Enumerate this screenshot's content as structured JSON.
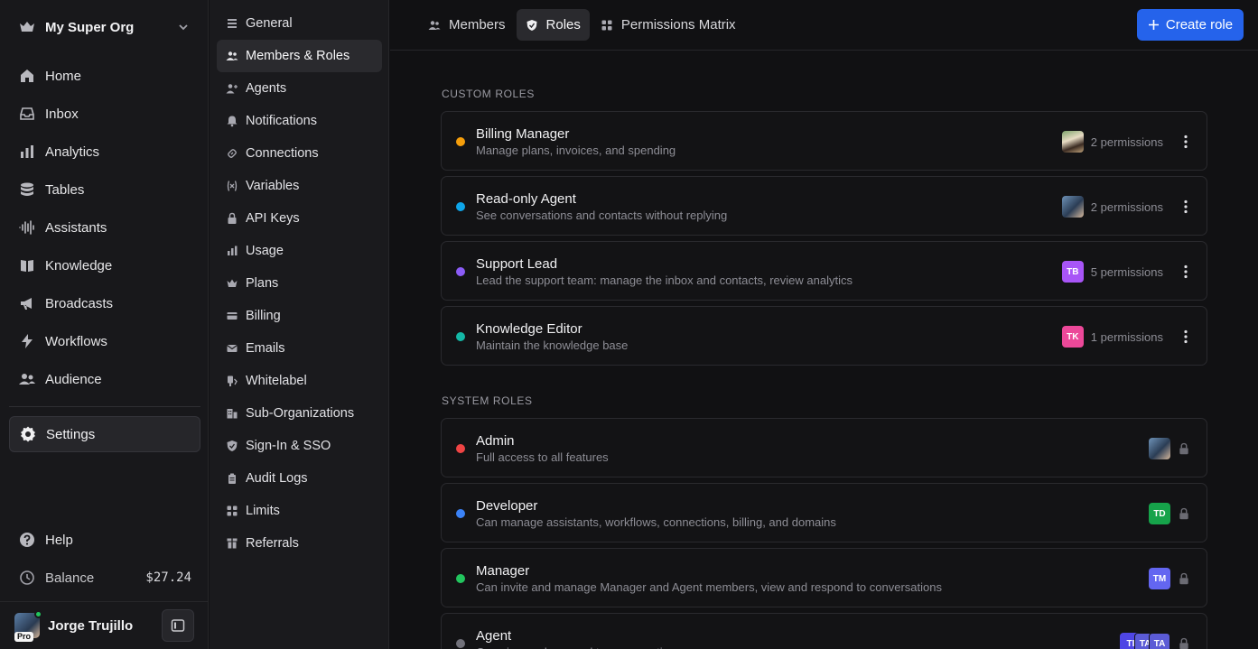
{
  "org": {
    "name": "My Super Org"
  },
  "nav": {
    "items": [
      {
        "label": "Home",
        "icon": "home-icon"
      },
      {
        "label": "Inbox",
        "icon": "inbox-icon"
      },
      {
        "label": "Analytics",
        "icon": "bar-chart-icon"
      },
      {
        "label": "Tables",
        "icon": "database-icon"
      },
      {
        "label": "Assistants",
        "icon": "waveform-icon"
      },
      {
        "label": "Knowledge",
        "icon": "book-icon"
      },
      {
        "label": "Broadcasts",
        "icon": "megaphone-icon"
      },
      {
        "label": "Workflows",
        "icon": "lightning-icon"
      },
      {
        "label": "Audience",
        "icon": "people-icon"
      }
    ],
    "settings": "Settings",
    "help": "Help",
    "balance_label": "Balance",
    "balance_value": "$27.24"
  },
  "user": {
    "name": "Jorge Trujillo",
    "badge": "Pro"
  },
  "subnav": {
    "items": [
      {
        "label": "General",
        "icon": "stack-icon"
      },
      {
        "label": "Members & Roles",
        "icon": "people-icon"
      },
      {
        "label": "Agents",
        "icon": "user-plus-icon"
      },
      {
        "label": "Notifications",
        "icon": "bell-icon"
      },
      {
        "label": "Connections",
        "icon": "link-icon"
      },
      {
        "label": "Variables",
        "icon": "variable-icon"
      },
      {
        "label": "API Keys",
        "icon": "lock-icon"
      },
      {
        "label": "Usage",
        "icon": "bar-chart-icon"
      },
      {
        "label": "Plans",
        "icon": "crown-icon"
      },
      {
        "label": "Billing",
        "icon": "credit-card-icon"
      },
      {
        "label": "Emails",
        "icon": "mail-icon"
      },
      {
        "label": "Whitelabel",
        "icon": "brush-icon"
      },
      {
        "label": "Sub-Organizations",
        "icon": "building-icon"
      },
      {
        "label": "Sign-In & SSO",
        "icon": "shield-icon"
      },
      {
        "label": "Audit Logs",
        "icon": "clipboard-icon"
      },
      {
        "label": "Limits",
        "icon": "grid-icon"
      },
      {
        "label": "Referrals",
        "icon": "gift-icon"
      }
    ],
    "active_index": 1
  },
  "tabs": [
    {
      "label": "Members",
      "icon": "people-icon"
    },
    {
      "label": "Roles",
      "icon": "shield-check-icon"
    },
    {
      "label": "Permissions Matrix",
      "icon": "grid-icon"
    }
  ],
  "active_tab": 1,
  "create_button": "Create role",
  "custom_roles": {
    "title": "CUSTOM ROLES",
    "items": [
      {
        "name": "Billing Manager",
        "description": "Manage plans, invoices, and spending",
        "color": "#f59e0b",
        "permissions": "2 permissions",
        "avatars": [
          "photo-a"
        ]
      },
      {
        "name": "Read-only Agent",
        "description": "See conversations and contacts without replying",
        "color": "#0ea5e9",
        "permissions": "2 permissions",
        "avatars": [
          "photo-b"
        ]
      },
      {
        "name": "Support Lead",
        "description": "Lead the support team: manage the inbox and contacts, review analytics",
        "color": "#8b5cf6",
        "permissions": "5 permissions",
        "avatars": [
          "TB"
        ]
      },
      {
        "name": "Knowledge Editor",
        "description": "Maintain the knowledge base",
        "color": "#14b8a6",
        "permissions": "1 permissions",
        "avatars": [
          "TK"
        ]
      }
    ]
  },
  "system_roles": {
    "title": "SYSTEM ROLES",
    "items": [
      {
        "name": "Admin",
        "description": "Full access to all features",
        "color": "#ef4444",
        "avatars": [
          "photo-b"
        ]
      },
      {
        "name": "Developer",
        "description": "Can manage assistants, workflows, connections, billing, and domains",
        "color": "#3b82f6",
        "avatars": [
          "TD"
        ]
      },
      {
        "name": "Manager",
        "description": "Can invite and manage Manager and Agent members, view and respond to conversations",
        "color": "#22c55e",
        "avatars": [
          "TM"
        ]
      },
      {
        "name": "Agent",
        "description": "Can view and respond to conversations",
        "color": "#71717a",
        "avatars": [
          "TI",
          "TA",
          "TA"
        ]
      }
    ]
  },
  "avatar_colors": {
    "TB": "#a855f7",
    "TK": "#ec4899",
    "TD": "#16a34a",
    "TM": "#6366f1",
    "TI": "#4f46e5",
    "TA": "#5b5bd6"
  }
}
